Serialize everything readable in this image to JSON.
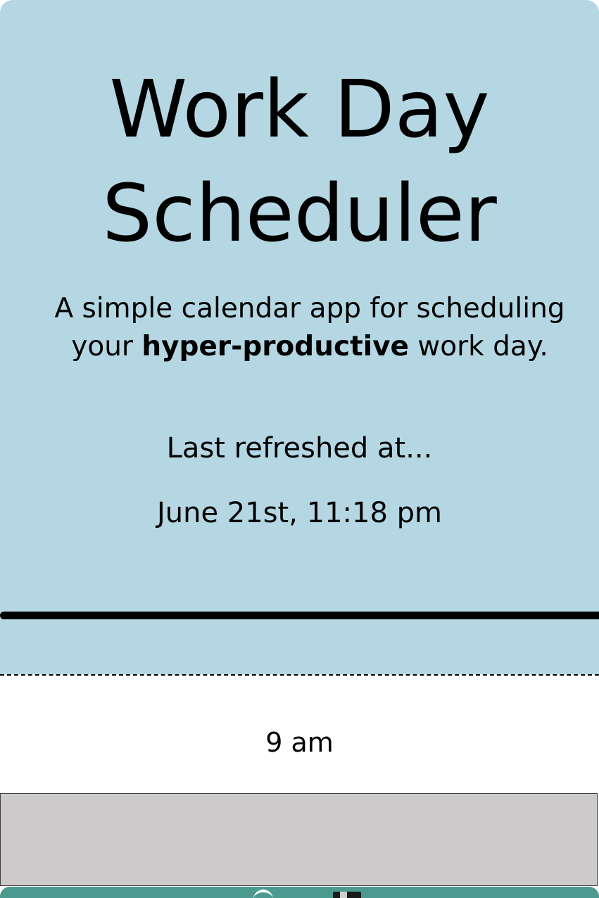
{
  "colors": {
    "header_bg": "#b5d7e4",
    "divider": "#000000",
    "past_block": "#cccacb",
    "save_button": "#4a9a90"
  },
  "header": {
    "title": "Work Day Scheduler",
    "lead_before": "A simple calendar app for scheduling your ",
    "lead_emphasis": "hyper-productive",
    "lead_after": " work day.",
    "refreshed_label": "Last refreshed at...",
    "refreshed_time": "June 21st, 11:18 pm"
  },
  "time_blocks": [
    {
      "hour": "9 am",
      "description": "",
      "save_icon": "save-icon"
    }
  ]
}
